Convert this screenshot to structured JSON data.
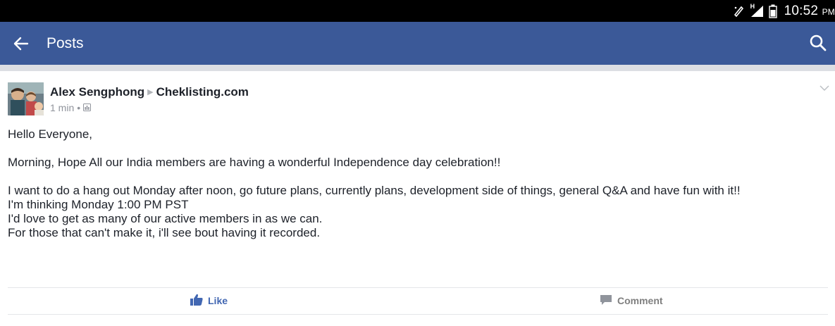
{
  "status_bar": {
    "network_label": "H",
    "time": "10:52",
    "ampm": "PM"
  },
  "app_bar": {
    "title": "Posts",
    "back_icon": "arrow-left-icon",
    "search_icon": "search-icon",
    "color": "#3b5998"
  },
  "post": {
    "author": "Alex Sengphong",
    "group": "Cheklisting.com",
    "time": "1 min",
    "privacy_icon": "group-icon",
    "lines": [
      "Hello Everyone,",
      "",
      "Morning, Hope All our India members are having a wonderful Independence day celebration!!",
      "",
      "I want to do a hang out Monday after noon, go future plans, currently plans, development side of things, general Q&A and have fun with it!!",
      "I'm thinking Monday 1:00 PM PST",
      "I'd love to get as many of our active members in as we can.",
      "For those that can't make it, i'll see bout having it recorded."
    ]
  },
  "actions": {
    "like_label": "Like",
    "comment_label": "Comment",
    "like_color": "#4267b2"
  }
}
